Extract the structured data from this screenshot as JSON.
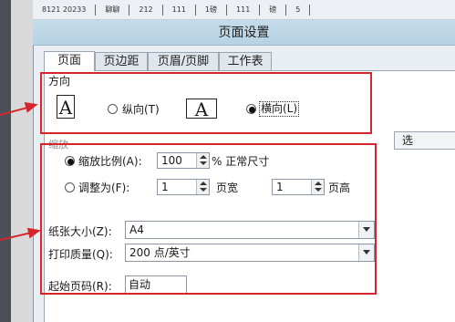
{
  "spreadsheet": {
    "column_snippets": [
      "8121 20233",
      "聊聊",
      "212",
      "111",
      "1磅",
      "111",
      "磅",
      "5"
    ]
  },
  "dialog": {
    "title": "页面设置",
    "tabs": [
      {
        "label": "页面",
        "active": true
      },
      {
        "label": "页边距",
        "active": false
      },
      {
        "label": "页眉/页脚",
        "active": false
      },
      {
        "label": "工作表",
        "active": false
      }
    ]
  },
  "orientation": {
    "section_label": "方向",
    "portrait_glyph": "A",
    "landscape_glyph": "A",
    "portrait_label": "纵向(T)",
    "landscape_label": "横向(L)",
    "selected": "landscape"
  },
  "scaling": {
    "section_label": "缩放",
    "options_button": "选",
    "adjust_ratio_label": "缩放比例(A):",
    "adjust_ratio_value": "100",
    "percent_label": "% 正常尺寸",
    "fit_to_label": "调整为(F):",
    "pages_wide_value": "1",
    "pages_wide_label": "页宽",
    "pages_tall_value": "1",
    "pages_tall_label": "页高",
    "selected": "adjust_ratio"
  },
  "paper": {
    "paper_size_label": "纸张大小(Z):",
    "paper_size_value": "A4",
    "print_quality_label": "打印质量(Q):",
    "print_quality_value": "200 点/英寸",
    "first_page_label": "起始页码(R):",
    "first_page_value": "自动"
  },
  "colors": {
    "highlight": "#d7262b",
    "titlebar": "#b6d2e3"
  }
}
